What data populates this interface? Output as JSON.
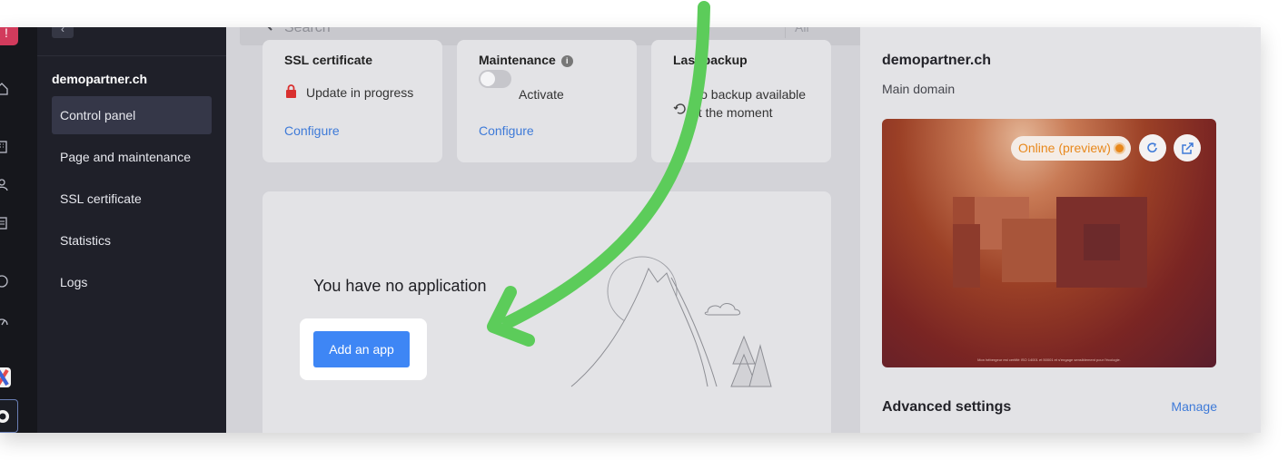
{
  "sidebar": {
    "site_name": "demopartner.ch",
    "items": [
      {
        "label": "Control panel",
        "active": true
      },
      {
        "label": "Page and maintenance",
        "active": false
      },
      {
        "label": "SSL certificate",
        "active": false
      },
      {
        "label": "Statistics",
        "active": false
      },
      {
        "label": "Logs",
        "active": false
      }
    ]
  },
  "header": {
    "search_placeholder": "Search",
    "search_scope": "All",
    "avatar_initial": "A"
  },
  "cards": {
    "ssl": {
      "title": "SSL certificate",
      "status": "Update in progress",
      "link": "Configure"
    },
    "maintenance": {
      "title": "Maintenance",
      "toggle_label": "Activate",
      "link": "Configure"
    },
    "backup": {
      "title": "Last backup",
      "text": "No backup available at the moment"
    }
  },
  "applications": {
    "empty_title": "You have no application",
    "add_button": "Add an app"
  },
  "domain_panel": {
    "domain": "demopartner.ch",
    "subtitle": "Main domain",
    "status": "Online (preview)",
    "status_color": "#e8881c",
    "preview_caption": "Mon hébergeur est certifié ISO 14001 et 50001 et s'engage sensiblement pour l'écologie.",
    "advanced_title": "Advanced settings",
    "manage_link": "Manage"
  },
  "colors": {
    "accent": "#3e86f5",
    "link": "#3e7ad8",
    "arrow": "#5ccc5a",
    "sidebar_bg": "#1f2029"
  }
}
